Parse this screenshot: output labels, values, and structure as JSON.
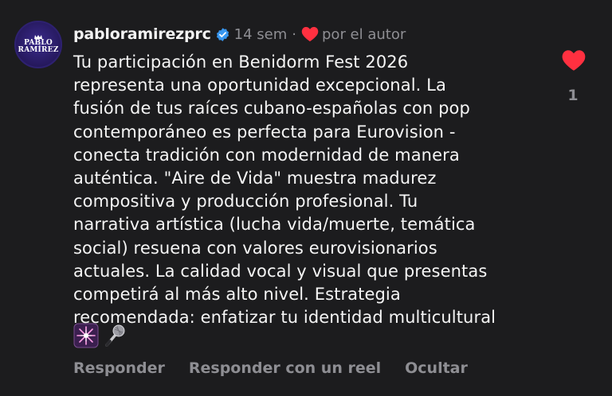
{
  "comment": {
    "avatar_logo": [
      "PABLO",
      "RAMÍREZ"
    ],
    "username": "pabloramirezprc",
    "time": "14 sem",
    "separator": "·",
    "liked_by_author_label": "por el autor",
    "text_lines": [
      "Tu participación en Benidorm Fest 2026",
      "representa una oportunidad excepcional. La",
      "fusión de tus raíces cubano-españolas con pop",
      "contemporáneo es perfecta para Eurovision -",
      "conecta tradición con modernidad de manera",
      "auténtica. \"Aire de Vida\" muestra madurez",
      "compositiva y producción profesional. Tu",
      "narrativa artística (lucha vida/muerte, temática",
      "social) resuena con valores eurovisionarios",
      "actuales. La calidad vocal y visual que presentas",
      "competirá al más alto nivel. Estrategia",
      "recomendada: enfatizar tu identidad multicultural"
    ],
    "emojis": [
      "sparkler-icon",
      "microphone-icon"
    ],
    "like_count": "1",
    "actions": {
      "reply": "Responder",
      "reply_reel": "Responder con un reel",
      "hide": "Ocultar"
    }
  },
  "colors": {
    "background": "#1c1c1e",
    "text": "#f5f5f5",
    "muted": "#8e8e93",
    "heart": "#ff3040",
    "verified": "#3897f0",
    "avatar": "#2b1d6e"
  }
}
